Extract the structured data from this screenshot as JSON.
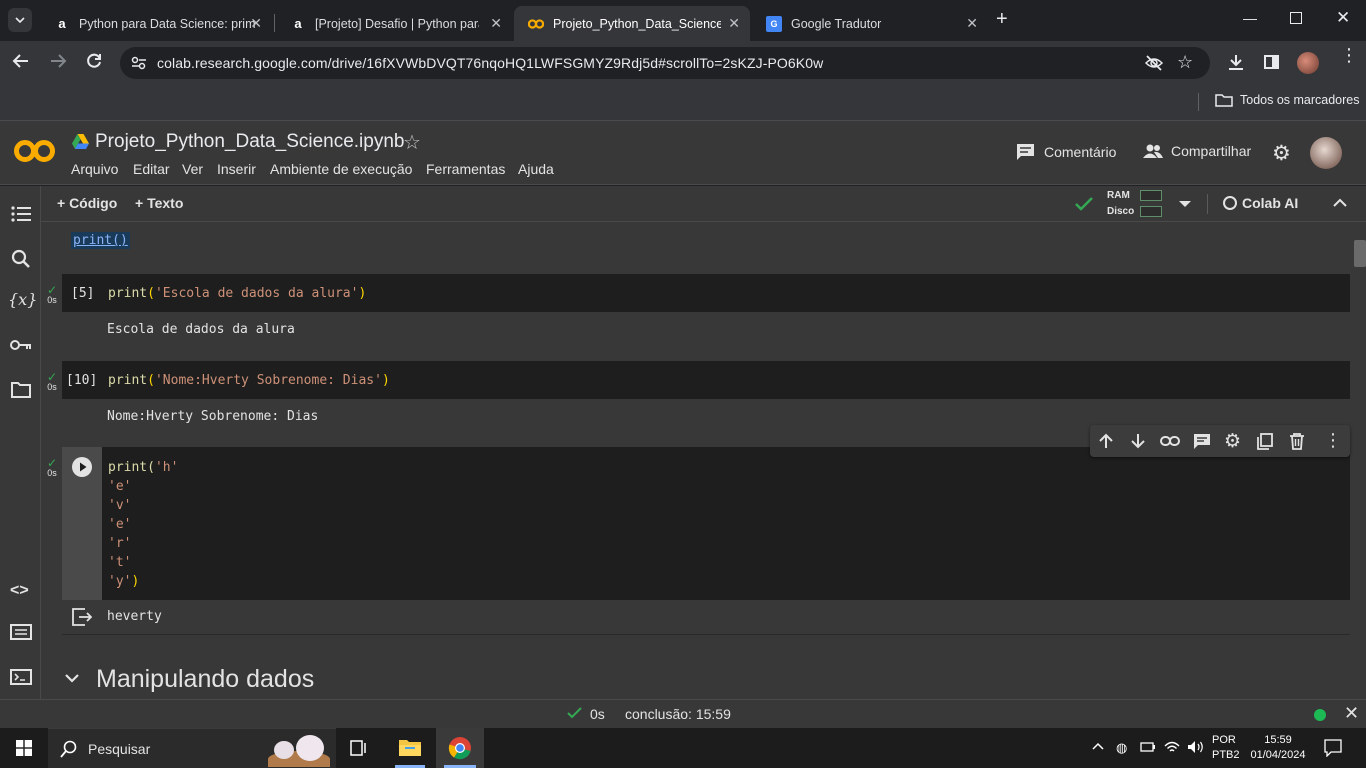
{
  "browser": {
    "tabs": [
      {
        "title": "Python para Data Science: prim",
        "icon": "alura-icon"
      },
      {
        "title": "[Projeto] Desafio | Python para",
        "icon": "alura-icon"
      },
      {
        "title": "Projeto_Python_Data_Science.ip",
        "icon": "colab-icon"
      },
      {
        "title": "Google Tradutor",
        "icon": "google-translate-icon"
      }
    ],
    "url": "colab.research.google.com/drive/16fXVWbDVQT76nqoHQ1LWFSGMYZ9Rdj5d#scrollTo=2sKZJ-PO6K0w",
    "bookmarks_label": "Todos os marcadores"
  },
  "colab": {
    "logo": "CO",
    "notebook_title": "Projeto_Python_Data_Science.ipynb",
    "menu": [
      "Arquivo",
      "Editar",
      "Ver",
      "Inserir",
      "Ambiente de execução",
      "Ferramentas",
      "Ajuda"
    ],
    "comment_label": "Comentário",
    "share_label": "Compartilhar",
    "add_code_label": "+ Código",
    "add_text_label": "+ Texto",
    "ram_label": "RAM",
    "disk_label": "Disco",
    "colab_ai_label": "Colab AI"
  },
  "cells": {
    "top_text": "print()",
    "cell5": {
      "count": "[5]",
      "fn": "print",
      "arg": "'Escola de dados da alura'",
      "output": "Escola de dados da alura",
      "time": "0s"
    },
    "cell10": {
      "count": "[10]",
      "fn": "print",
      "arg": "'Nome:Hverty Sobrenome: Dias'",
      "output": "Nome:Hverty Sobrenome: Dias",
      "time": "0s"
    },
    "cell_active": {
      "fn": "print(",
      "lines": [
        "'h'",
        "'e'",
        "'v'",
        "'e'",
        "'r'",
        "'t'",
        "'y'"
      ],
      "close": ")",
      "output": "heverty",
      "time": "0s"
    },
    "section_heading": "Manipulando dados"
  },
  "status": {
    "time": "0s",
    "conclusion": "conclusão: 15:59"
  },
  "taskbar": {
    "search_placeholder": "Pesquisar",
    "lang1": "POR",
    "lang2": "PTB2",
    "clock_time": "15:59",
    "clock_date": "01/04/2024"
  },
  "colors": {
    "colab_orange": "#f9ab00",
    "green": "#34a853",
    "string": "#ce9178",
    "func": "#ffd700"
  }
}
